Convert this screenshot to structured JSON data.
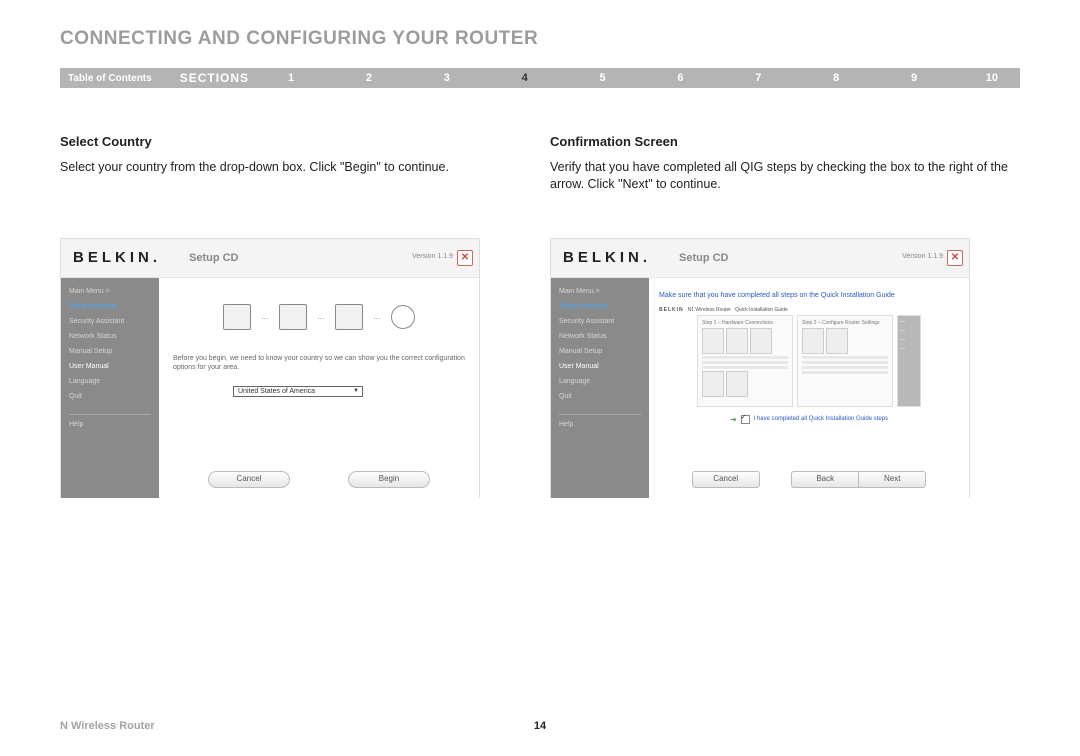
{
  "title": "CONNECTING AND CONFIGURING YOUR ROUTER",
  "nav": {
    "toc": "Table of Contents",
    "sections_label": "SECTIONS",
    "items": [
      "1",
      "2",
      "3",
      "4",
      "5",
      "6",
      "7",
      "8",
      "9",
      "10"
    ],
    "active": "4"
  },
  "left": {
    "heading": "Select Country",
    "desc": "Select your country from the drop-down box. Click \"Begin\" to continue.",
    "shot": {
      "brand": "BELKIN",
      "setup": "Setup CD",
      "version": "Version 1.1.9",
      "sidebar": {
        "mainmenu": "Main Menu  >",
        "items": [
          "Setup Assistant",
          "Security Assistant",
          "Network Status",
          "Manual Setup",
          "User Manual",
          "Language",
          "Quit"
        ],
        "active": "Setup Assistant",
        "white": "User Manual",
        "help": "Help"
      },
      "msg": "Before you begin, we need to know your country so we can show you the correct configuration options for your area.",
      "dropdown": "United States of America",
      "cancel": "Cancel",
      "begin": "Begin"
    }
  },
  "right": {
    "heading": "Confirmation Screen",
    "desc": "Verify that you have completed all QIG steps by checking the box to the right of the arrow. Click \"Next\" to continue.",
    "shot": {
      "brand": "BELKIN",
      "setup": "Setup CD",
      "version": "Version 1.1.9",
      "sidebar": {
        "mainmenu": "Main Menu  >",
        "items": [
          "Setup Assistant",
          "Security Assistant",
          "Network Status",
          "Manual Setup",
          "User Manual",
          "Language",
          "Quit"
        ],
        "active": "Setup Assistant",
        "white": "User Manual",
        "help": "Help"
      },
      "note": "Make sure that you have completed all steps on the Quick Installation Guide",
      "qig_brand": "BELKIN",
      "qig_label1": "N1 Wireless Router",
      "qig_label2": "Quick Installation Guide",
      "card1_hd": "Step 1 – Hardware Connections",
      "card2_hd": "Step 2 – Configure Router Settings",
      "completed": "I have completed all Quick Installation Guide steps",
      "cancel": "Cancel",
      "back": "Back",
      "next": "Next"
    }
  },
  "footer": {
    "product": "N Wireless Router",
    "page": "14"
  }
}
